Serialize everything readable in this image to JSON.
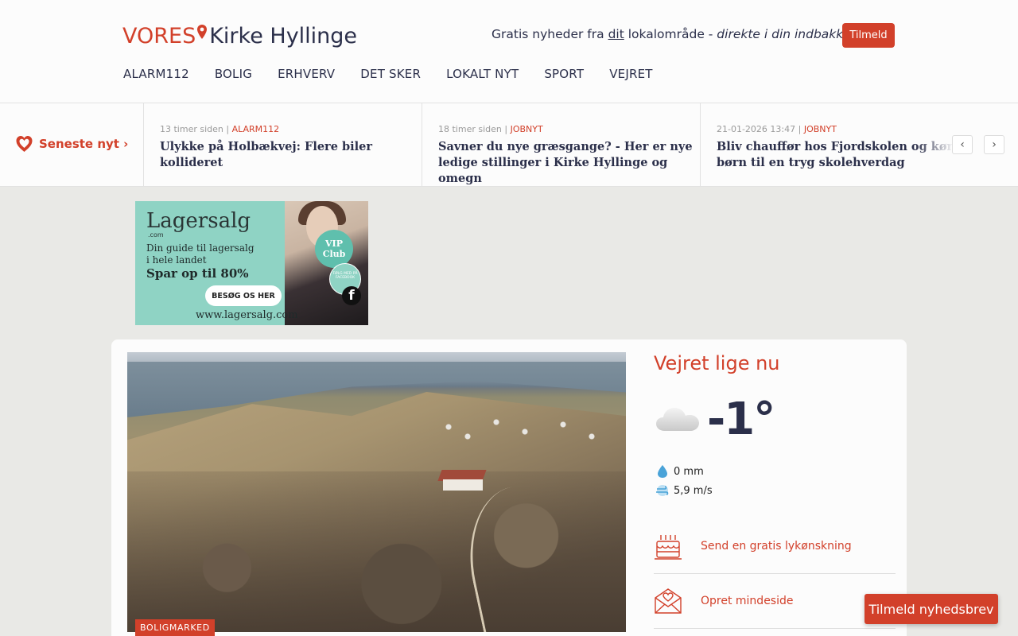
{
  "header": {
    "logo_brand": "VORES",
    "logo_town": "Kirke Hyllinge",
    "tagline_pre": "Gratis nyheder fra ",
    "tagline_underline": "dit",
    "tagline_mid": " lokalområde - ",
    "tagline_italic": "direkte i din indbakke",
    "subscribe_label": "Tilmeld",
    "nav": [
      "ALARM112",
      "BOLIG",
      "ERHVERV",
      "DET SKER",
      "LOKALT NYT",
      "SPORT",
      "VEJRET"
    ]
  },
  "ticker": {
    "latest_label": "Seneste nyt ›",
    "items": [
      {
        "time": "13 timer siden",
        "category": "ALARM112",
        "title": "Ulykke på Holbækvej: Flere biler kollideret"
      },
      {
        "time": "18 timer siden",
        "category": "JOBNYT",
        "title": "Savner du nye græsgange? - Her er nye ledige stillinger i Kirke Hyllinge og omegn"
      },
      {
        "time": "21-01-2026 13:47",
        "category": "JOBNYT",
        "title": "Bliv chauffør hos Fjordskolen og kør børn til en tryg skolehverdag"
      }
    ],
    "prev": "‹",
    "next": "›"
  },
  "ad": {
    "brand": "Lagersalg",
    "com": ".com",
    "guide_line1": "Din guide til lagersalg",
    "guide_line2": "i hele landet",
    "offer": "Spar op til 80%",
    "cta": "BESØG OS HER",
    "url": "www.lagersalg.com",
    "vip_line1": "VIP",
    "vip_line2": "Club",
    "fb_text": "FØLG MED PÅ FACEBOOK",
    "fb_letter": "f"
  },
  "article": {
    "tag": "BOLIGMARKED"
  },
  "weather": {
    "title": "Vejret lige nu",
    "temperature": "-1°",
    "precipitation": "0 mm",
    "wind": "5,9 m/s",
    "icon": "cloud-icon"
  },
  "links": [
    {
      "label": "Send en gratis lykønskning",
      "icon": "cake-icon"
    },
    {
      "label": "Opret mindeside",
      "icon": "memorial-envelope-icon"
    }
  ],
  "newsletter_button": "Tilmeld nyhedsbrev",
  "colors": {
    "accent": "#d2402a",
    "navy": "#2b2f4a",
    "background": "#e9e9e6"
  }
}
